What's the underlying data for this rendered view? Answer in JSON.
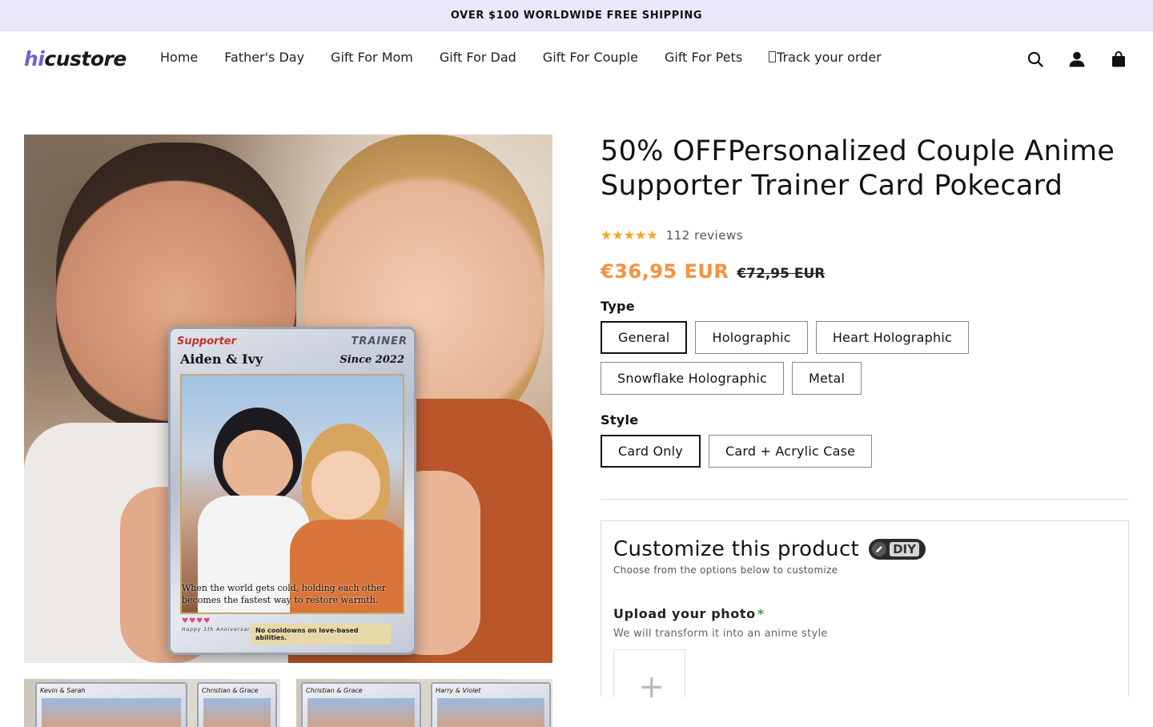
{
  "announcement": "OVER $100 WORLDWIDE FREE SHIPPING",
  "logo": {
    "part1": "hi",
    "part2": "custore"
  },
  "nav": [
    "Home",
    "Father's Day",
    "Gift For Mom",
    "Gift For Dad",
    "Gift For Couple",
    "Gift For Pets",
    "Track your order"
  ],
  "header_icons": [
    "search-icon",
    "account-icon",
    "cart-icon"
  ],
  "product": {
    "title": "50% OFFPersonalized Couple Anime Supporter Trainer Card Pokecard",
    "rating": 5,
    "reviews": "112 reviews",
    "price_sale": "€36,95 EUR",
    "price_original": "€72,95 EUR",
    "type_label": "Type",
    "type_options": [
      "General",
      "Holographic",
      "Heart Holographic",
      "Snowflake Holographic",
      "Metal"
    ],
    "type_selected": "General",
    "style_label": "Style",
    "style_options": [
      "Card Only",
      "Card + Acrylic Case"
    ],
    "style_selected": "Card Only"
  },
  "hero_card": {
    "tag": "Supporter",
    "kind": "TRAINER",
    "names": "Aiden & Ivy",
    "since": "Since 2022",
    "quote": "When the world gets cold, holding each other becomes the fastest way to restore warmth.",
    "footer": "No cooldowns on love-based abilities.",
    "anniversary": "Happy 1th Anniversary"
  },
  "thumbnails": [
    {
      "cards": [
        "Kevin & Sarah",
        "Christian & Grace"
      ]
    },
    {
      "cards": [
        "Christian & Grace",
        "Harry & Violet"
      ]
    }
  ],
  "customize": {
    "title": "Customize this product",
    "badge": "DIY",
    "subtitle": "Choose from the options below to customize",
    "upload_title": "Upload your photo",
    "upload_required": "*",
    "upload_sub": "We will transform it into an anime style"
  },
  "colors": {
    "accent": "#f7913e",
    "announce_bg": "#e9e8fb",
    "logo_accent": "#6b63d6",
    "star": "#f2a624"
  }
}
